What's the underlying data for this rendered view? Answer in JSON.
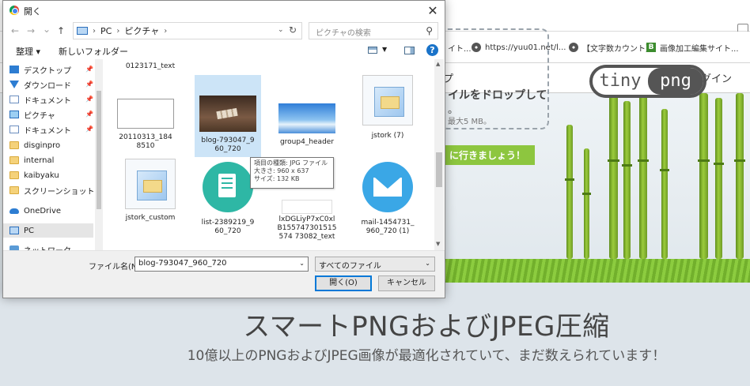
{
  "bookmarks": [
    {
      "label": "イト...",
      "icon": "none"
    },
    {
      "label": "https://yuu01.net/l...",
      "icon": "globe-icon"
    },
    {
      "label": "【文字数カウント】",
      "icon": "globe-icon"
    },
    {
      "label": "画像加工編集サイト...",
      "icon": "bookmark-b-icon"
    }
  ],
  "site": {
    "header_tail": "プ",
    "login": "ログイン",
    "drop_text": "イルをドロップして",
    "drop_sub1": "。",
    "drop_sub2": "最大5 MB。",
    "cta": "に行きましょう！",
    "logo_tiny": "tiny",
    "logo_png": "png",
    "title": "スマートPNGおよびJPEG圧縮",
    "subtitle": "10億以上のPNGおよびJPEG画像が最適化されていて、まだ数えられています！"
  },
  "dialog": {
    "title": "開く",
    "close": "✕",
    "nav": {
      "back": "←",
      "forward": "→",
      "recent": "⌄",
      "up": "↑"
    },
    "address": {
      "root": "PC",
      "folder": "ピクチャ"
    },
    "search_placeholder": "ピクチャの検索",
    "toolbar": {
      "organize": "整理 ▾",
      "new_folder": "新しいフォルダー",
      "help": "?"
    },
    "nav_items": [
      {
        "label": "デスクトップ",
        "icon": "desktop-icon",
        "pinned": true
      },
      {
        "label": "ダウンロード",
        "icon": "download-icon",
        "pinned": true
      },
      {
        "label": "ドキュメント",
        "icon": "document-icon",
        "pinned": true
      },
      {
        "label": "ピクチャ",
        "icon": "pictures-icon",
        "pinned": true
      },
      {
        "label": "ドキュメント",
        "icon": "document-icon",
        "pinned": true
      },
      {
        "label": "disginpro",
        "icon": "folder-icon",
        "pinned": false
      },
      {
        "label": "internal",
        "icon": "folder-icon",
        "pinned": false
      },
      {
        "label": "kaibyaku",
        "icon": "folder-icon",
        "pinned": false
      },
      {
        "label": "スクリーンショット",
        "icon": "folder-icon",
        "pinned": false
      },
      {
        "label": "OneDrive",
        "icon": "onedrive-icon",
        "pinned": false
      },
      {
        "label": "PC",
        "icon": "pc-icon",
        "pinned": false
      },
      {
        "label": "ネットワーク",
        "icon": "network-icon",
        "pinned": false
      }
    ],
    "files": [
      {
        "name": "0123171_text",
        "thumb": "none"
      },
      {
        "name": "20110313_1848510",
        "thumb": "white"
      },
      {
        "name": "blog-793047_960_720",
        "thumb": "photo"
      },
      {
        "name": "group4_header",
        "thumb": "sky"
      },
      {
        "name": "jstork (7)",
        "thumb": "box"
      },
      {
        "name": "jstork_custom",
        "thumb": "box"
      },
      {
        "name": "list-2389219_960_720",
        "thumb": "green"
      },
      {
        "name": "lxDGLiyP7xC0xlB155747301515574 73082_text",
        "thumb": "doc"
      },
      {
        "name": "mail-1454731_960_720 (1)",
        "thumb": "blue"
      }
    ],
    "tooltip": {
      "type": "項目の種類: JPG ファイル",
      "size": "大きさ: 960 x 637",
      "filesize": "サイズ: 132 KB"
    },
    "filename_label": "ファイル名(N):",
    "filename_value": "blog-793047_960_720",
    "filetype": "すべてのファイル",
    "open": "開く(O)",
    "cancel": "キャンセル"
  }
}
